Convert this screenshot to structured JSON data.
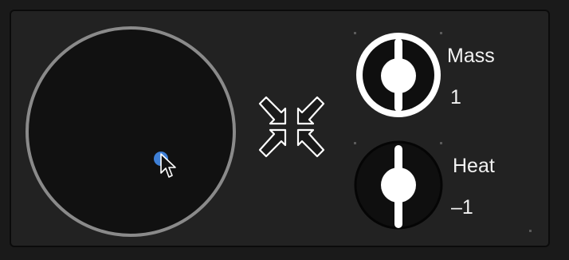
{
  "controls": {
    "mass": {
      "label": "Mass",
      "value": "1"
    },
    "heat": {
      "label": "Heat",
      "value": "–1"
    }
  },
  "colors": {
    "background": "#1a1a1a",
    "panel": "#222222",
    "pad_ring": "#8a8a8a",
    "puck": "#3e7fd6",
    "foreground": "#ffffff"
  },
  "icons": {
    "compress": "compress-arrows-icon",
    "cursor": "arrow-cursor-icon"
  }
}
